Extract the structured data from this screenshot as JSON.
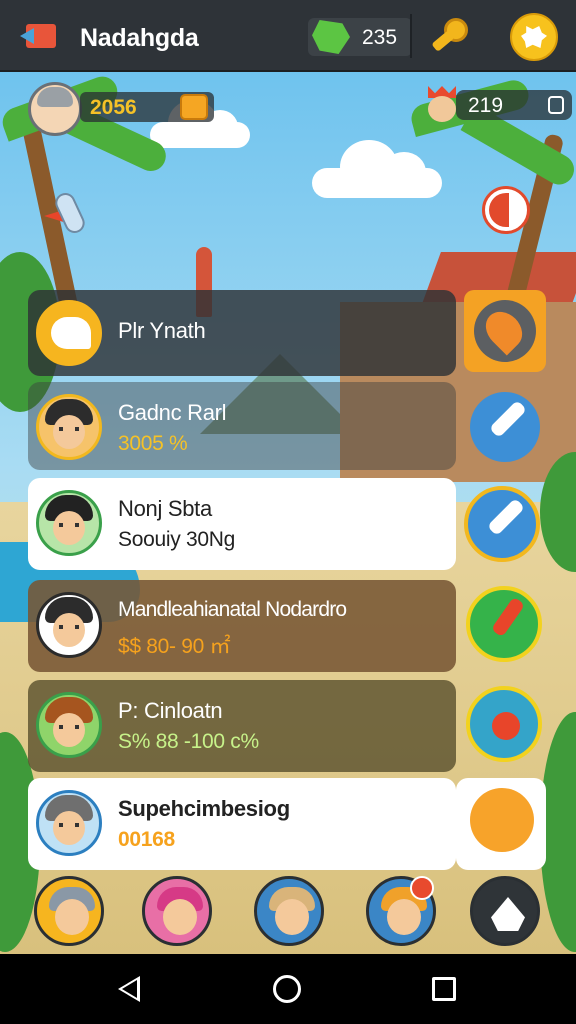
{
  "header": {
    "title": "Nadahgda",
    "gems": "235",
    "icons": {
      "back": "back-arrow-icon",
      "gem": "gem-icon",
      "key": "key-icon",
      "settings": "gear-icon"
    }
  },
  "hud": {
    "coins": "2056",
    "round": "219"
  },
  "list": {
    "items": [
      {
        "title": "Plr Ynath",
        "sub": ""
      },
      {
        "title": "Gadnc Rarl",
        "sub": "3005 %"
      },
      {
        "title": "Nonj Sbta",
        "sub": "Soouiy 30Ng"
      },
      {
        "title": "Mandleahianatal Nodardro",
        "sub": "$$ 80- 90 ㎡"
      },
      {
        "title": "P: Cinloatn",
        "sub": "S% 88 -100 c%"
      },
      {
        "title": "Supehcimbesiog",
        "sub": "00168"
      }
    ]
  },
  "colors": {
    "topbar": "#2e3338",
    "accent_gold": "#f5c227",
    "card_white": "#ffffff",
    "nav": "#000000"
  }
}
